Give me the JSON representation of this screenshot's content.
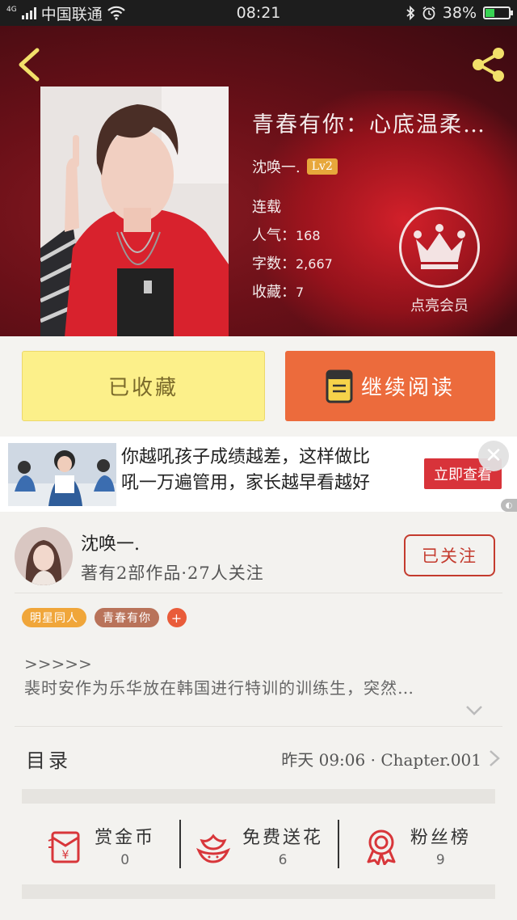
{
  "status_bar": {
    "network": "4G",
    "carrier": "中国联通",
    "time": "08:21",
    "battery": "38%",
    "battery_level": 0.38
  },
  "book": {
    "title": "青春有你：心底温柔…",
    "author": "沈唤一.",
    "level": "Lv2",
    "status": "连载",
    "popularity_label": "人气：",
    "popularity": "168",
    "words_label": "字数：",
    "words": "2,667",
    "favorites_label": "收藏：",
    "favorites": "7",
    "vip_label": "点亮会员"
  },
  "actions": {
    "favorite": "已收藏",
    "continue_reading": "继续阅读"
  },
  "ad": {
    "line1": "你越吼孩子成绩越差，这样做比",
    "line2": "吼一万遍管用，家长越早看越好",
    "cta": "立即查看",
    "close": "✕"
  },
  "author_card": {
    "name": "沈唤一.",
    "stats": "著有2部作品·27人关注",
    "follow": "已关注"
  },
  "tags": [
    "明星同人",
    "青春有你",
    "+"
  ],
  "description": {
    "line1": ">>>>>",
    "line2": "裴时安作为乐华放在韩国进行特训的训练生，突然…"
  },
  "catalog": {
    "label": "目录",
    "latest": "昨天 09:06 · Chapter.001"
  },
  "stats": [
    {
      "name": "赏金币",
      "value": "0",
      "icon": "red-envelope-icon"
    },
    {
      "name": "免费送花",
      "value": "6",
      "icon": "flower-icon"
    },
    {
      "name": "粉丝榜",
      "value": "9",
      "icon": "medal-icon"
    }
  ],
  "colors": {
    "accent": "#ec6b3c",
    "favorite_bg": "#fcf08a",
    "follow": "#c43b2e",
    "hero": "#8a1a22"
  }
}
